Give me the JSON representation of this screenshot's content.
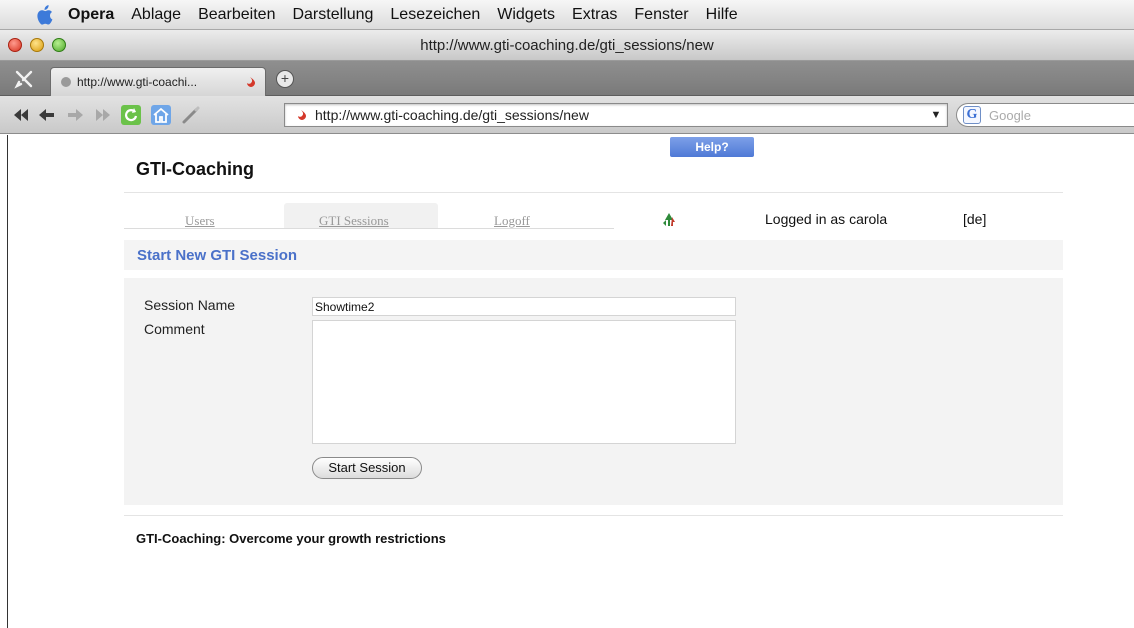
{
  "menubar": {
    "app": "Opera",
    "items": [
      "Ablage",
      "Bearbeiten",
      "Darstellung",
      "Lesezeichen",
      "Widgets",
      "Extras",
      "Fenster",
      "Hilfe"
    ]
  },
  "window": {
    "title": "http://www.gti-coaching.de/gti_sessions/new"
  },
  "tabbar": {
    "tab_label": "http://www.gti-coachi..."
  },
  "toolbar": {
    "url": "http://www.gti-coaching.de/gti_sessions/new",
    "search_placeholder": "Google"
  },
  "page": {
    "help_label": "Help?",
    "site_title": "GTI-Coaching",
    "nav": {
      "users": "Users",
      "sessions": "GTI Sessions",
      "logoff": "Logoff",
      "logged_in": "Logged in as carola",
      "lang": "[de]"
    },
    "section_title": "Start New GTI Session",
    "form": {
      "session_name_label": "Session Name",
      "session_name_value": "Showtime2",
      "comment_label": "Comment",
      "comment_value": "",
      "submit_label": "Start Session"
    },
    "footer": "GTI-Coaching: Overcome your growth restrictions"
  },
  "colors": {
    "accent": "#4a71c9",
    "help_button": "#5b83dc",
    "link_gray": "#999999"
  },
  "icons": [
    "apple-icon",
    "tools-icon",
    "tab-close-icon",
    "favicon-icon",
    "new-tab-icon",
    "rewind-icon",
    "back-icon",
    "forward-icon",
    "fast-forward-icon",
    "reload-icon",
    "home-icon",
    "wand-icon",
    "dropdown-icon",
    "google-icon",
    "tree-icon"
  ]
}
